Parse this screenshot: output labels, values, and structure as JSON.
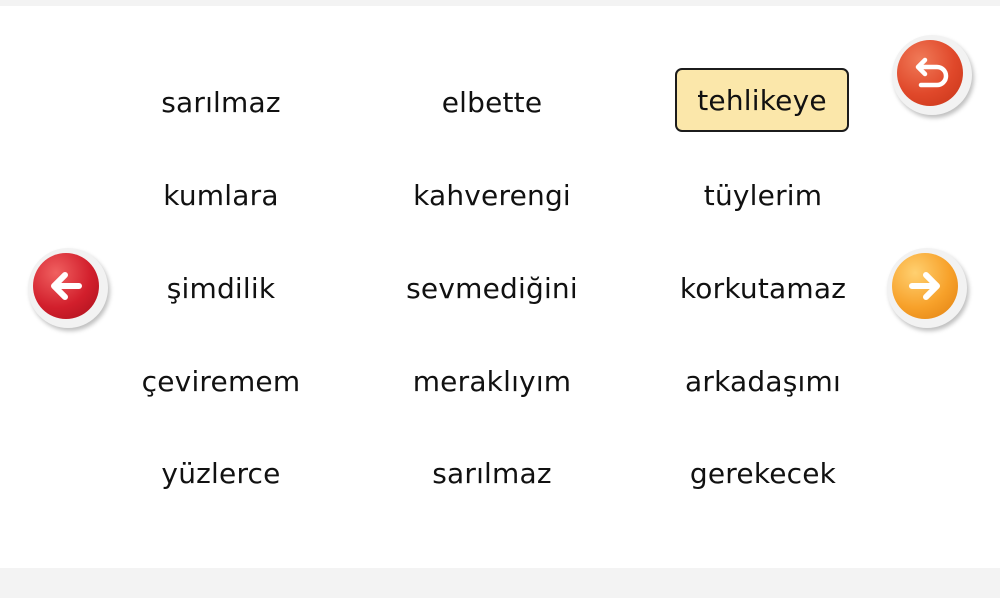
{
  "words": {
    "r1c1": "sarılmaz",
    "r1c2": "elbette",
    "r1c3": "tehlikeye",
    "r2c1": "kumlara",
    "r2c2": "kahverengi",
    "r2c3": "tüylerim",
    "r3c1": "şimdilik",
    "r3c2": "sevmediğini",
    "r3c3": "korkutamaz",
    "r4c1": "çeviremem",
    "r4c2": "meraklıyım",
    "r4c3": "arkadaşımı",
    "r5c1": "yüzlerce",
    "r5c2": "sarılmaz",
    "r5c3": "gerekecek"
  },
  "selected_word": "tehlikeye",
  "colors": {
    "selected_bg": "#fbe7aa",
    "back_button": "#d21f2c",
    "next_button": "#f7a12a",
    "return_button": "#e0482a"
  },
  "icons": {
    "back": "arrow-left-icon",
    "next": "arrow-right-icon",
    "return": "return-arrow-icon"
  }
}
